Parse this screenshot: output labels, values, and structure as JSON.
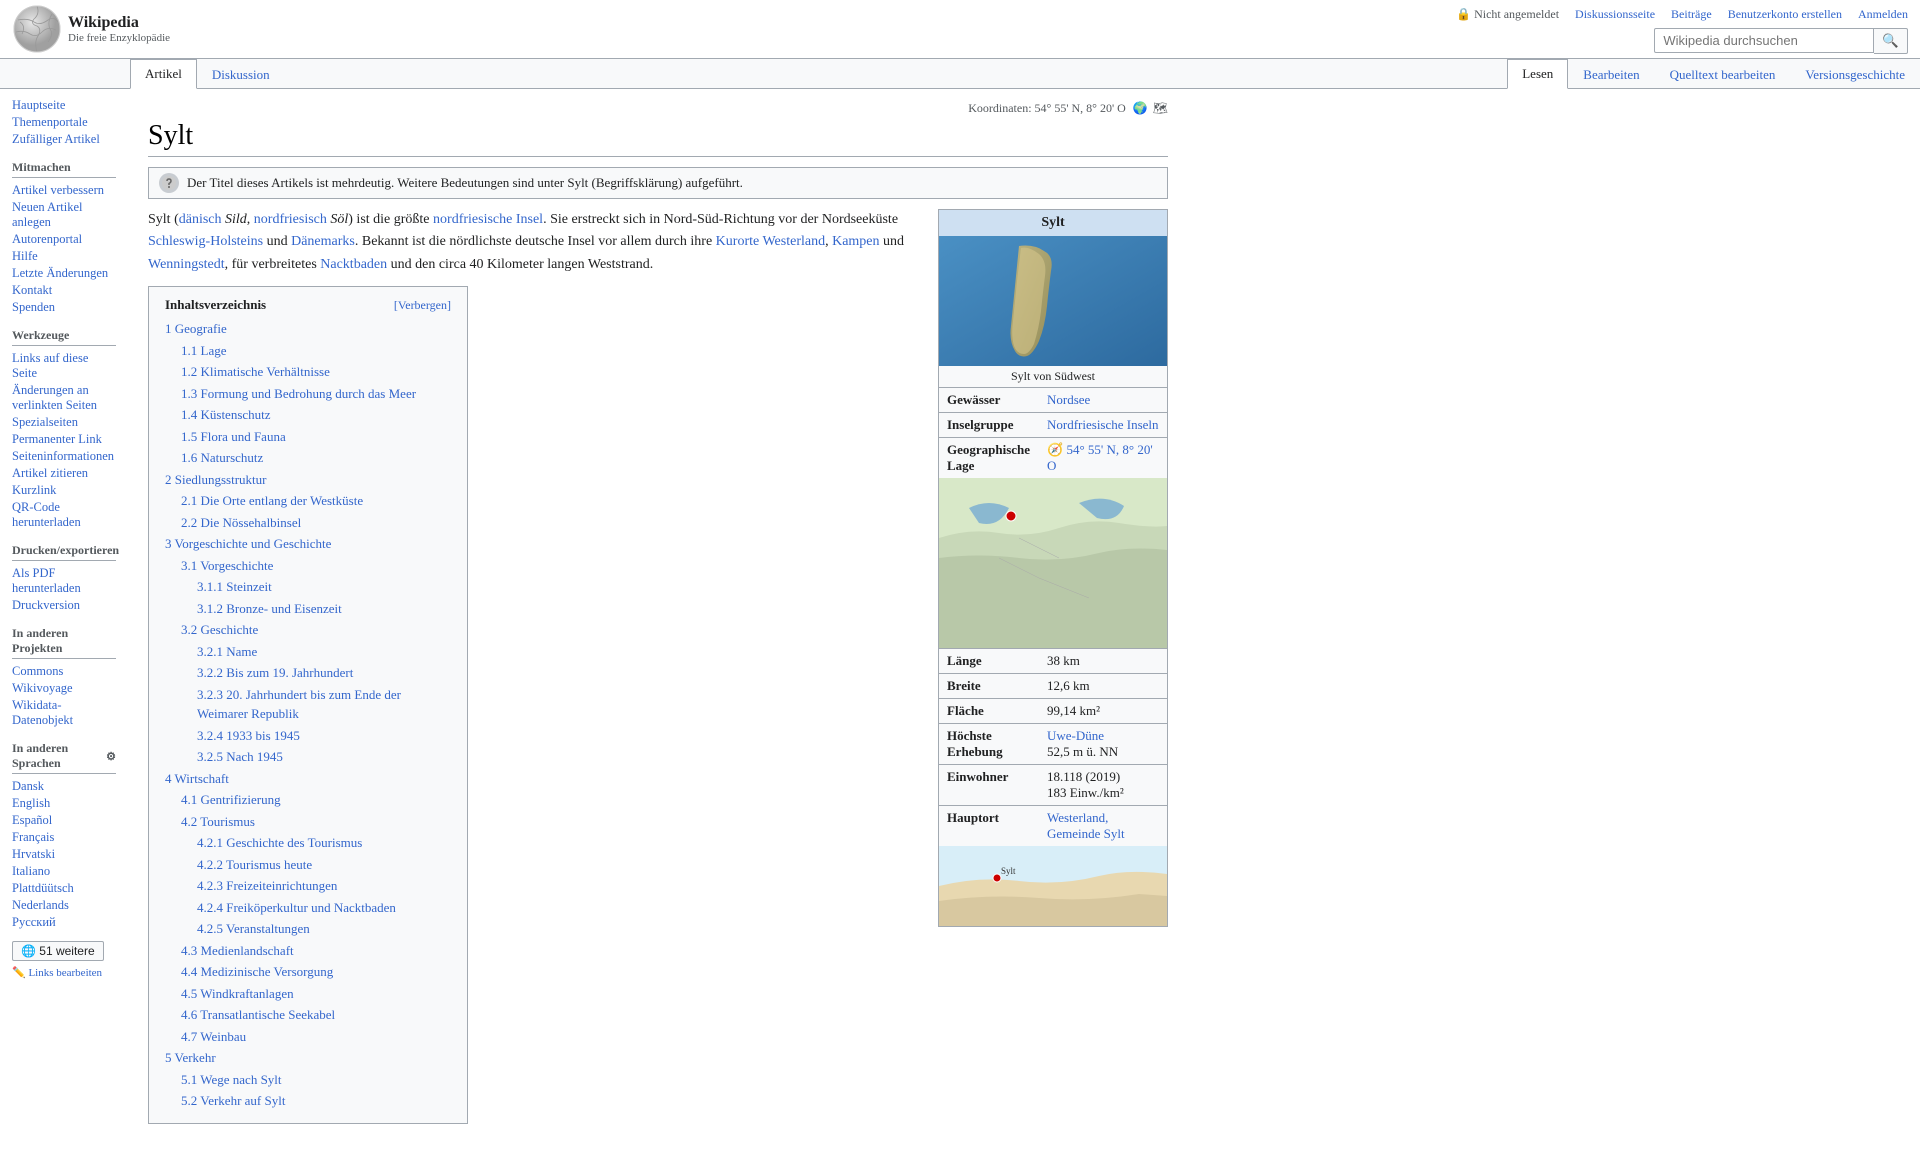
{
  "header": {
    "logo_title": "Wikipedia",
    "logo_subtitle": "Die freie Enzyklopädie",
    "not_logged_in": "Nicht angemeldet",
    "nav_links": [
      "Diskussionsseite",
      "Beiträge",
      "Benutzerkonto erstellen",
      "Anmelden"
    ],
    "search_placeholder": "Wikipedia durchsuchen"
  },
  "tabs": {
    "left": [
      "Artikel",
      "Diskussion"
    ],
    "right": [
      "Lesen",
      "Bearbeiten",
      "Quelltext bearbeiten",
      "Versionsgeschichte"
    ],
    "active_left": "Artikel",
    "active_right": "Lesen"
  },
  "sidebar": {
    "sections": [
      {
        "title": "",
        "items": [
          "Hauptseite",
          "Themenportale",
          "Zufälliger Artikel"
        ]
      },
      {
        "title": "Mitmachen",
        "items": [
          "Artikel verbessern",
          "Neuen Artikel anlegen",
          "Autorenportal",
          "Hilfe",
          "Letzte Änderungen",
          "Kontakt",
          "Spenden"
        ]
      },
      {
        "title": "Werkzeuge",
        "items": [
          "Links auf diese Seite",
          "Änderungen an verlinkten Seiten",
          "Spezialseiten",
          "Permanenter Link",
          "Seiteninformationen",
          "Artikel zitieren",
          "Kurzlink",
          "QR-Code herunterladen"
        ]
      },
      {
        "title": "Drucken/exportieren",
        "items": [
          "Als PDF herunterladen",
          "Druckversion"
        ]
      },
      {
        "title": "In anderen Projekten",
        "items": [
          "Commons",
          "Wikivoyage",
          "Wikidata-Datenobjekt"
        ]
      },
      {
        "title": "In anderen Sprachen",
        "items": [
          "Dansk",
          "English",
          "Español",
          "Français",
          "Hrvatski",
          "Italiano",
          "Plattdüütsch",
          "Nederlands",
          "Русский"
        ],
        "extra_btn": "51 weitere",
        "edit_link": "Links bearbeiten"
      }
    ]
  },
  "page": {
    "title": "Sylt",
    "coords": "Koordinaten: 54° 55' N, 8° 20' O",
    "hatnote": "Der Titel dieses Artikels ist mehrdeutig. Weitere Bedeutungen sind unter Sylt (Begriffsklärung) aufgeführt.",
    "intro": "Sylt (dänisch Sild, nordfriesisch Söl) ist die größte nordfriesische Insel. Sie erstreckt sich in Nord-Süd-Richtung vor der Nordseeküste Schleswig-Holsteins und Dänemarks. Bekannt ist die nördlichste deutsche Insel vor allem durch ihre Kurorte Westerland, Kampen und Wenningstedt, für verbreitetes Nacktbaden und den circa 40 Kilometer langen Weststrand."
  },
  "toc": {
    "title": "Inhaltsverzeichnis",
    "toggle_label": "[Verbergen]",
    "items": [
      {
        "num": "1",
        "label": "Geografie",
        "sub": [
          {
            "num": "1.1",
            "label": "Lage"
          },
          {
            "num": "1.2",
            "label": "Klimatische Verhältnisse"
          },
          {
            "num": "1.3",
            "label": "Formung und Bedrohung durch das Meer"
          },
          {
            "num": "1.4",
            "label": "Küstenschutz"
          },
          {
            "num": "1.5",
            "label": "Flora und Fauna"
          },
          {
            "num": "1.6",
            "label": "Naturschutz"
          }
        ]
      },
      {
        "num": "2",
        "label": "Siedlungsstruktur",
        "sub": [
          {
            "num": "2.1",
            "label": "Die Orte entlang der Westküste"
          },
          {
            "num": "2.2",
            "label": "Die Nössehalbinsel"
          }
        ]
      },
      {
        "num": "3",
        "label": "Vorgeschichte und Geschichte",
        "sub": [
          {
            "num": "3.1",
            "label": "Vorgeschichte",
            "sub2": [
              {
                "num": "3.1.1",
                "label": "Steinzeit"
              },
              {
                "num": "3.1.2",
                "label": "Bronze- und Eisenzeit"
              }
            ]
          },
          {
            "num": "3.2",
            "label": "Geschichte",
            "sub2": [
              {
                "num": "3.2.1",
                "label": "Name"
              },
              {
                "num": "3.2.2",
                "label": "Bis zum 19. Jahrhundert"
              },
              {
                "num": "3.2.3",
                "label": "20. Jahrhundert bis zum Ende der Weimarer Republik"
              },
              {
                "num": "3.2.4",
                "label": "1933 bis 1945"
              },
              {
                "num": "3.2.5",
                "label": "Nach 1945"
              }
            ]
          }
        ]
      },
      {
        "num": "4",
        "label": "Wirtschaft",
        "sub": [
          {
            "num": "4.1",
            "label": "Gentrifizierung"
          },
          {
            "num": "4.2",
            "label": "Tourismus",
            "sub2": [
              {
                "num": "4.2.1",
                "label": "Geschichte des Tourismus"
              },
              {
                "num": "4.2.2",
                "label": "Tourismus heute"
              },
              {
                "num": "4.2.3",
                "label": "Freizeiteinrichtungen"
              },
              {
                "num": "4.2.4",
                "label": "Freiköperkultur und Nacktbaden"
              },
              {
                "num": "4.2.5",
                "label": "Veranstaltungen"
              }
            ]
          },
          {
            "num": "4.3",
            "label": "Medienlandschaft"
          },
          {
            "num": "4.4",
            "label": "Medizinische Versorgung"
          },
          {
            "num": "4.5",
            "label": "Windkraftanlagen"
          },
          {
            "num": "4.6",
            "label": "Transatlantische Seekabel"
          },
          {
            "num": "4.7",
            "label": "Weinbau"
          }
        ]
      },
      {
        "num": "5",
        "label": "Verkehr",
        "sub": [
          {
            "num": "5.1",
            "label": "Wege nach Sylt"
          },
          {
            "num": "5.2",
            "label": "Verkehr auf Sylt"
          }
        ]
      }
    ]
  },
  "infobox": {
    "title": "Sylt",
    "image_caption": "Sylt von Südwest",
    "map_caption": "",
    "rows": [
      {
        "label": "Gewässer",
        "value": "Nordsee"
      },
      {
        "label": "Inselgruppe",
        "value": "Nordfriesische Inseln"
      },
      {
        "label": "Geographische Lage",
        "value": "54° 55' N, 8° 20' O"
      },
      {
        "label": "Länge",
        "value": "38 km"
      },
      {
        "label": "Breite",
        "value": "12,6 km"
      },
      {
        "label": "Fläche",
        "value": "99,14 km²"
      },
      {
        "label": "Höchste Erhebung",
        "value": "Uwe-Düne\n52,5 m ü. NN"
      },
      {
        "label": "Einwohner",
        "value": "18.118 (2019)\n183 Einw./km²"
      },
      {
        "label": "Hauptort",
        "value": "Westerland, Gemeinde Sylt"
      }
    ]
  }
}
